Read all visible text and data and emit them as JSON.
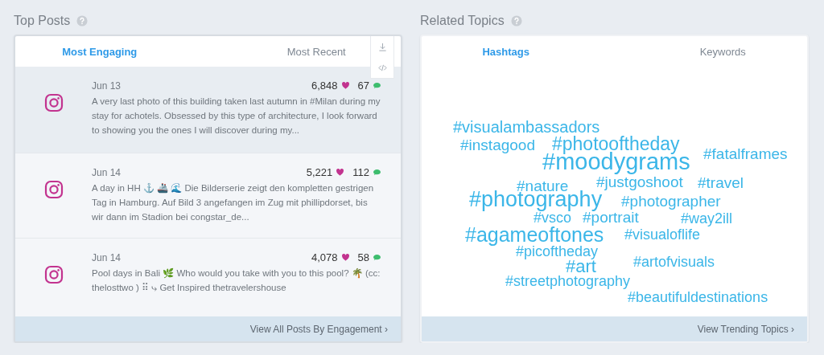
{
  "panels": [
    {
      "kind": "posts",
      "title": "Top Posts",
      "tabs": [
        {
          "label": "Most Engaging",
          "selected": true
        },
        {
          "label": "Most Recent",
          "selected": false
        }
      ],
      "posts": [
        {
          "date": "Jun 13",
          "likes": "6,848",
          "comments": "67",
          "highlighted": true,
          "text": "A very last photo of this building taken last autumn in #Milan during my stay for achotels. Obsessed by this type of architecture, I look forward to showing you the ones I will discover during my..."
        },
        {
          "date": "Jun 14",
          "likes": "5,221",
          "comments": "112",
          "highlighted": false,
          "text": "A day in HH ⚓ 🚢 🌊  Die Bilderserie zeigt den kompletten gestrigen Tag in Hamburg. Auf Bild 3 angefangen im Zug mit phillipdorset, bis wir dann im Stadion bei congstar_de..."
        },
        {
          "date": "Jun 14",
          "likes": "4,078",
          "comments": "58",
          "highlighted": false,
          "text": "Pool days in Bali 🌿  Who would you take with you to this pool? 🌴 (cc: thelosttwo ) ⠿ ⤷ Get Inspired thetravelershouse"
        }
      ],
      "footer": "View All Posts By Engagement ›"
    },
    {
      "kind": "cloud",
      "title": "Related Topics",
      "tabs": [
        {
          "label": "Hashtags",
          "selected": true
        },
        {
          "label": "Keywords",
          "selected": false
        }
      ],
      "tags": [
        "#visualambassadors",
        "#instagood",
        "#photooftheday",
        "#moodygrams",
        "#fatalframes",
        "#nature",
        "#justgoshoot",
        "#travel",
        "#photography",
        "#photographer",
        "#vsco",
        "#portrait",
        "#way2ill",
        "#agameoftones",
        "#visualoflife",
        "#picoftheday",
        "#art",
        "#artofvisuals",
        "#streetphotography",
        "#beautifuldestinations"
      ],
      "footer": "View Trending Topics ›"
    }
  ]
}
